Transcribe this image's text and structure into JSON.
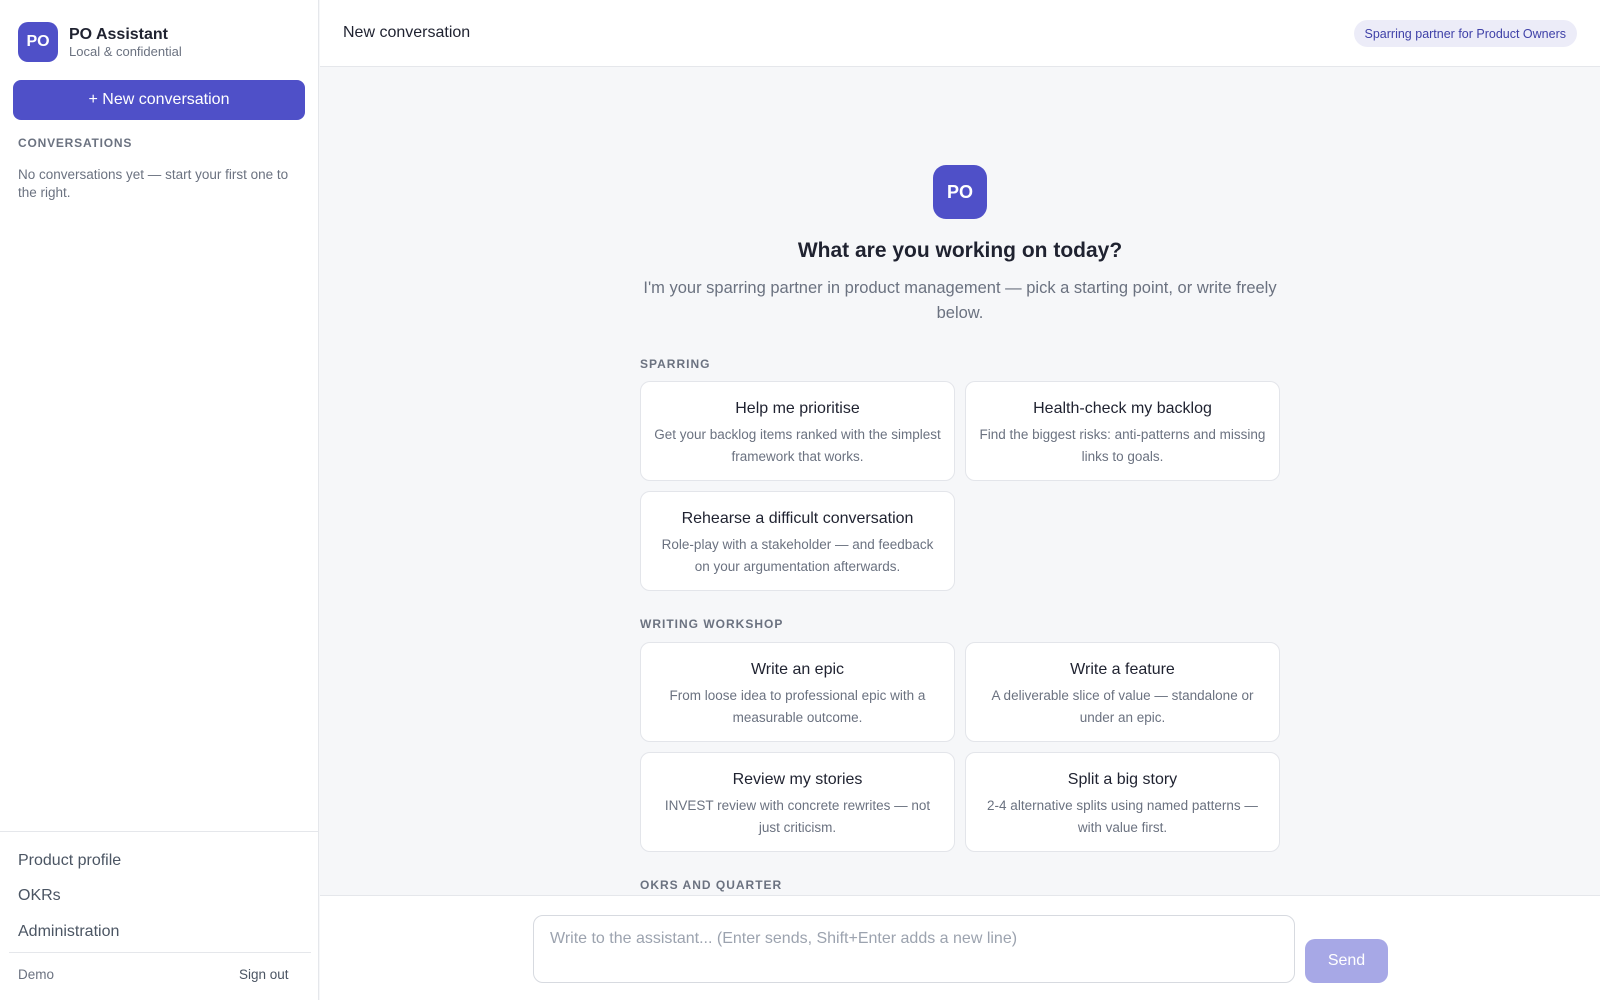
{
  "brand": {
    "avatar_text": "PO",
    "name": "PO Assistant",
    "subtitle": "Local & confidential"
  },
  "sidebar": {
    "new_conversation_label": "+ New conversation",
    "conversations_heading": "CONVERSATIONS",
    "empty_text": "No conversations yet — start your first one to the right.",
    "links": [
      {
        "label": "Product profile"
      },
      {
        "label": "OKRs"
      },
      {
        "label": "Administration"
      }
    ],
    "footer": {
      "user": "Demo",
      "sign_out": "Sign out"
    }
  },
  "header": {
    "title": "New conversation",
    "badge": "Sparring partner for Product Owners"
  },
  "welcome": {
    "avatar_text": "PO",
    "title": "What are you working on today?",
    "subtitle": "I'm your sparring partner in product management — pick a starting point, or write freely below."
  },
  "sections": [
    {
      "label": "SPARRING",
      "cards": [
        {
          "title": "Help me prioritise",
          "desc": "Get your backlog items ranked with the simplest framework that works."
        },
        {
          "title": "Health-check my backlog",
          "desc": "Find the biggest risks: anti-patterns and missing links to goals."
        },
        {
          "title": "Rehearse a difficult conversation",
          "desc": "Role-play with a stakeholder — and feedback on your argumentation afterwards."
        }
      ]
    },
    {
      "label": "WRITING WORKSHOP",
      "cards": [
        {
          "title": "Write an epic",
          "desc": "From loose idea to professional epic with a measurable outcome."
        },
        {
          "title": "Write a feature",
          "desc": "A deliverable slice of value — standalone or under an epic."
        },
        {
          "title": "Review my stories",
          "desc": "INVEST review with concrete rewrites — not just criticism."
        },
        {
          "title": "Split a big story",
          "desc": "2-4 alternative splits using named patterns — with value first."
        }
      ]
    },
    {
      "label": "OKRS AND QUARTER",
      "cards": []
    }
  ],
  "composer": {
    "placeholder": "Write to the assistant... (Enter sends, Shift+Enter adds a new line)",
    "send_label": "Send"
  },
  "colors": {
    "accent": "#4f50c8",
    "accent_disabled": "#a7a8e6",
    "badge_bg": "#ececf8",
    "page_bg": "#f6f7f9"
  }
}
